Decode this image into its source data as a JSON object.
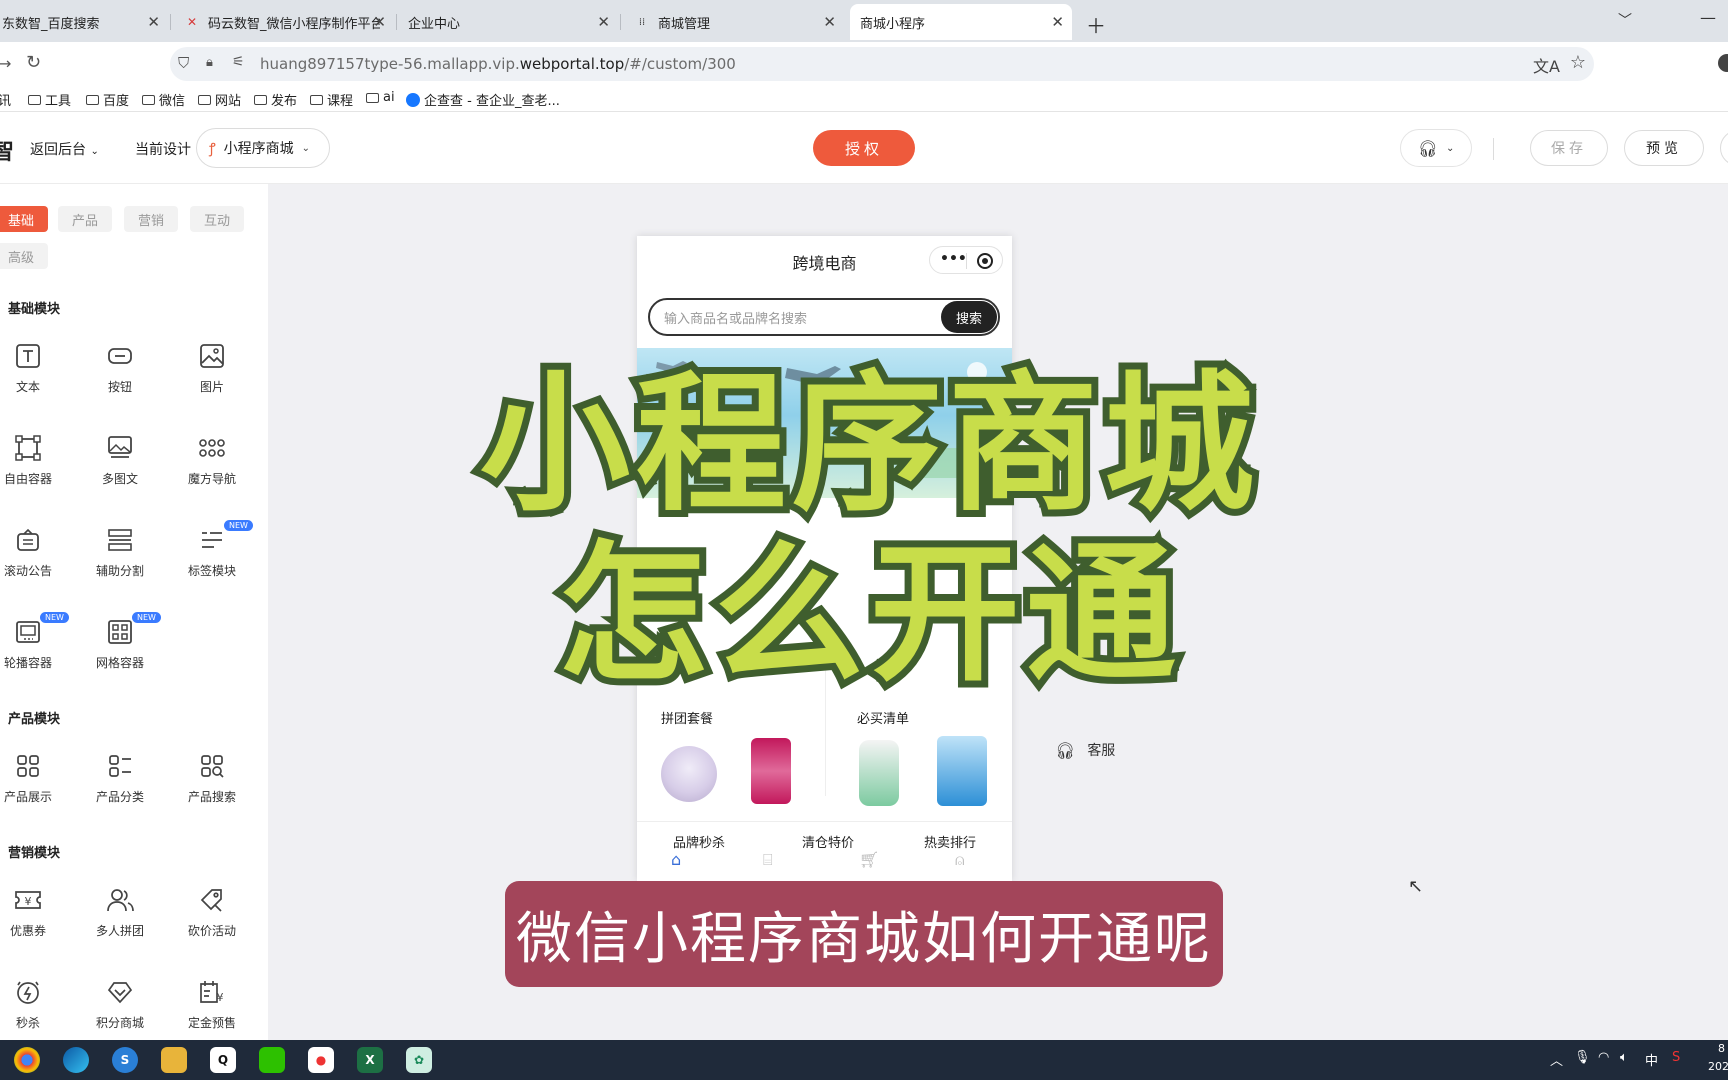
{
  "browser": {
    "tabs": [
      {
        "label": "东数智_百度搜索",
        "favicon": "paw-icon"
      },
      {
        "label": "码云数智_微信小程序制作平台_",
        "favicon": "mayun-logo"
      },
      {
        "label": "企业中心",
        "favicon": "blank-icon"
      },
      {
        "label": "商城管理",
        "favicon": "bars-icon"
      },
      {
        "label": "商城小程序",
        "favicon": "blank-icon"
      }
    ],
    "active_tab": 4,
    "url_prefix": "huang897157type-56.mallapp.vip.",
    "url_domain": "webportal.top",
    "url_suffix": "/#/custom/300",
    "bookmarks": [
      "讯",
      "工具",
      "百度",
      "微信",
      "网站",
      "发布",
      "课程",
      "ai",
      "企查查 - 查企业_查老..."
    ]
  },
  "header": {
    "brand_char": "智",
    "back_label": "返回后台",
    "current_design_label": "当前设计",
    "design_name": "小程序商城",
    "auth_label": "授权",
    "save_label": "保存",
    "preview_label": "预览"
  },
  "sidebar": {
    "tabs": [
      "基础",
      "产品",
      "营销",
      "互动",
      "高级"
    ],
    "sections": [
      {
        "title": "基础模块",
        "items": [
          {
            "label": "文本",
            "icon": "text-icon",
            "badge": ""
          },
          {
            "label": "按钮",
            "icon": "button-icon",
            "badge": ""
          },
          {
            "label": "图片",
            "icon": "image-icon",
            "badge": ""
          },
          {
            "label": "自由容器",
            "icon": "free-container-icon",
            "badge": ""
          },
          {
            "label": "多图文",
            "icon": "multi-image-icon",
            "badge": ""
          },
          {
            "label": "魔方导航",
            "icon": "cube-nav-icon",
            "badge": ""
          },
          {
            "label": "滚动公告",
            "icon": "notice-icon",
            "badge": ""
          },
          {
            "label": "辅助分割",
            "icon": "divider-icon",
            "badge": ""
          },
          {
            "label": "标签模块",
            "icon": "tag-icon",
            "badge": "NEW"
          },
          {
            "label": "轮播容器",
            "icon": "carousel-icon",
            "badge": "NEW"
          },
          {
            "label": "网格容器",
            "icon": "grid-icon",
            "badge": "NEW"
          }
        ]
      },
      {
        "title": "产品模块",
        "items": [
          {
            "label": "产品展示",
            "icon": "product-display-icon",
            "badge": ""
          },
          {
            "label": "产品分类",
            "icon": "product-category-icon",
            "badge": ""
          },
          {
            "label": "产品搜索",
            "icon": "product-search-icon",
            "badge": ""
          }
        ]
      },
      {
        "title": "营销模块",
        "items": [
          {
            "label": "优惠券",
            "icon": "coupon-icon",
            "badge": ""
          },
          {
            "label": "多人拼团",
            "icon": "group-buy-icon",
            "badge": ""
          },
          {
            "label": "砍价活动",
            "icon": "bargain-icon",
            "badge": ""
          },
          {
            "label": "秒杀",
            "icon": "flash-sale-icon",
            "badge": ""
          },
          {
            "label": "积分商城",
            "icon": "points-mall-icon",
            "badge": ""
          },
          {
            "label": "定金预售",
            "icon": "presale-icon",
            "badge": ""
          }
        ]
      }
    ]
  },
  "phone": {
    "title": "跨境电商",
    "search_placeholder": "输入商品名或品牌名搜索",
    "search_button": "搜索",
    "deal_left": "拼团套餐",
    "deal_right": "必买清单",
    "categories": [
      "品牌秒杀",
      "清仓特价",
      "热卖排行"
    ]
  },
  "side_panel": {
    "service_label": "客服"
  },
  "overlay": {
    "line1": "小程序商城",
    "line2": "怎么开通",
    "subtitle": "微信小程序商城如何开通呢"
  },
  "taskbar": {
    "tray_ime": "中",
    "tray_clock_top": "8",
    "tray_clock_bottom": "202"
  },
  "colors": {
    "accent": "#ee5a3c",
    "overlay_fill": "#c8dd4a",
    "overlay_stroke": "#3f5e2e",
    "subtitle_bg": "#a3455a"
  }
}
